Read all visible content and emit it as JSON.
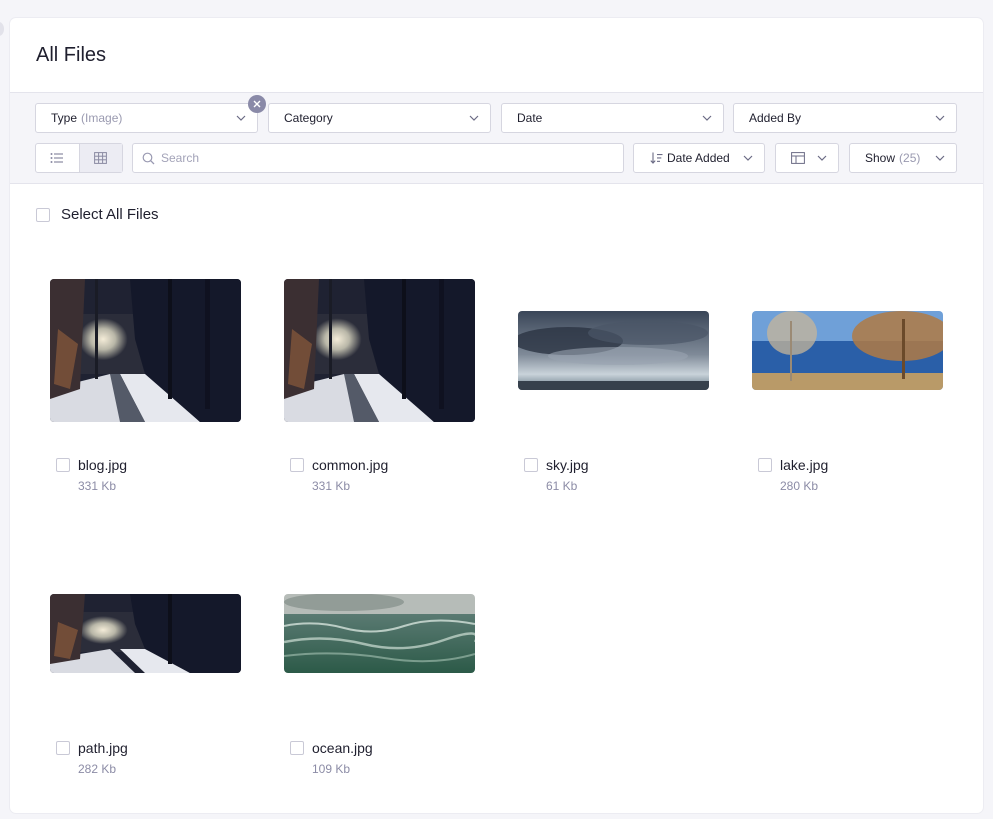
{
  "header": {
    "title": "All Files"
  },
  "filters": {
    "type_label": "Type",
    "type_value": "(Image)",
    "category_label": "Category",
    "date_label": "Date",
    "added_by_label": "Added By"
  },
  "toolbar": {
    "search_placeholder": "Search",
    "sort_label": "Date Added",
    "show_label": "Show",
    "show_value": "(25)",
    "active_view": "grid"
  },
  "select_all_label": "Select All Files",
  "files": [
    {
      "name": "blog.jpg",
      "size": "331 Kb"
    },
    {
      "name": "common.jpg",
      "size": "331 Kb"
    },
    {
      "name": "sky.jpg",
      "size": "61 Kb"
    },
    {
      "name": "lake.jpg",
      "size": "280 Kb"
    },
    {
      "name": "path.jpg",
      "size": "282 Kb"
    },
    {
      "name": "ocean.jpg",
      "size": "109 Kb"
    }
  ]
}
